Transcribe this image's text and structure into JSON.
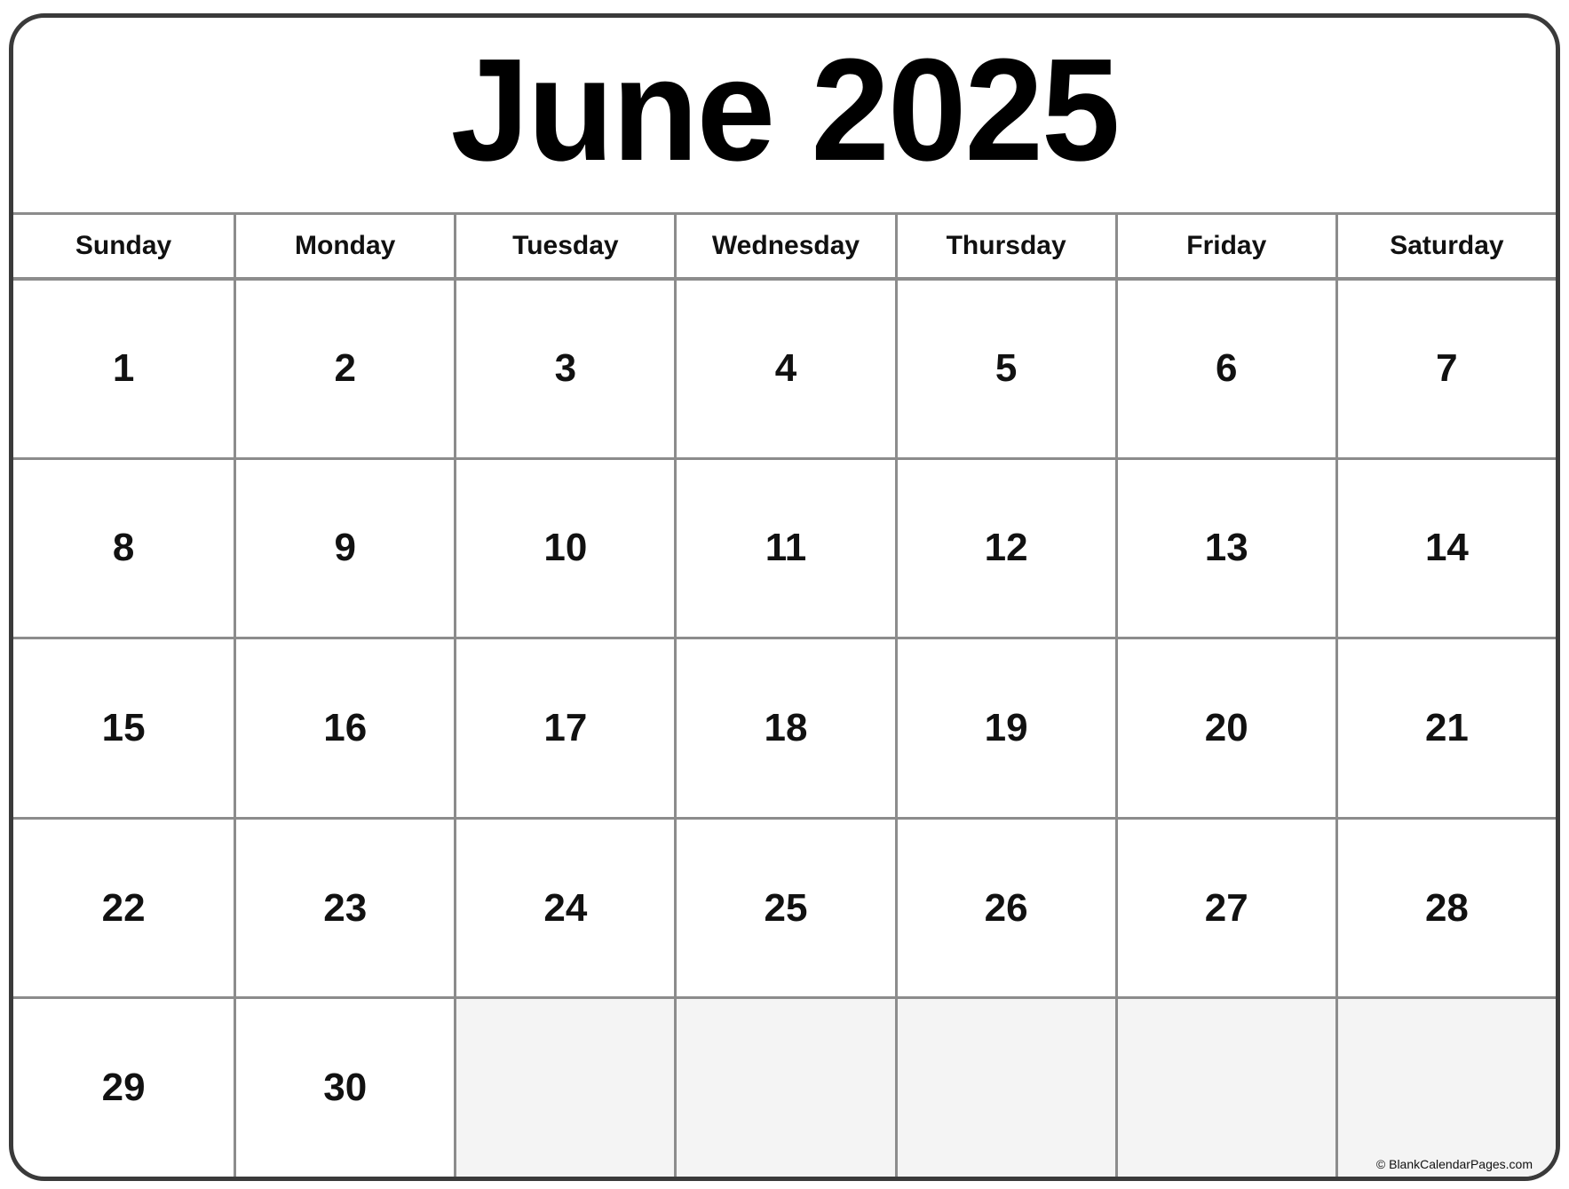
{
  "calendar": {
    "title": "June 2025",
    "month": "June",
    "year": 2025,
    "weekdays": [
      "Sunday",
      "Monday",
      "Tuesday",
      "Wednesday",
      "Thursday",
      "Friday",
      "Saturday"
    ],
    "weeks": [
      [
        "1",
        "2",
        "3",
        "4",
        "5",
        "6",
        "7"
      ],
      [
        "8",
        "9",
        "10",
        "11",
        "12",
        "13",
        "14"
      ],
      [
        "15",
        "16",
        "17",
        "18",
        "19",
        "20",
        "21"
      ],
      [
        "22",
        "23",
        "24",
        "25",
        "26",
        "27",
        "28"
      ],
      [
        "29",
        "30",
        "",
        "",
        "",
        "",
        ""
      ]
    ],
    "credit": "© BlankCalendarPages.com",
    "colors": {
      "frame_border": "#3a3a3a",
      "grid_line": "#8c8c8c",
      "empty_cell": "#f4f4f4",
      "text": "#000000"
    }
  }
}
